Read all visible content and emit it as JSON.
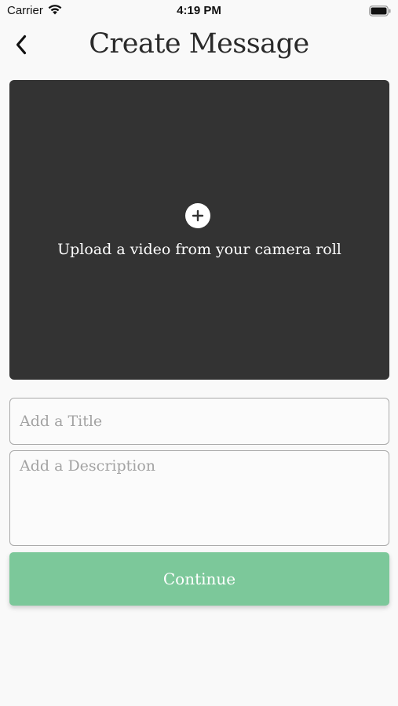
{
  "status_bar": {
    "carrier": "Carrier",
    "time": "4:19 PM",
    "wifi_icon": "wifi-icon",
    "battery_icon": "battery-icon"
  },
  "header": {
    "title": "Create Message",
    "back_icon": "chevron-left-icon"
  },
  "upload": {
    "icon": "plus-circle-icon",
    "label": "Upload a video from your camera roll",
    "background_color": "#333333"
  },
  "form": {
    "title_placeholder": "Add a Title",
    "title_value": "",
    "description_placeholder": "Add a Description",
    "description_value": ""
  },
  "continue": {
    "label": "Continue",
    "color": "#7cc89a"
  }
}
